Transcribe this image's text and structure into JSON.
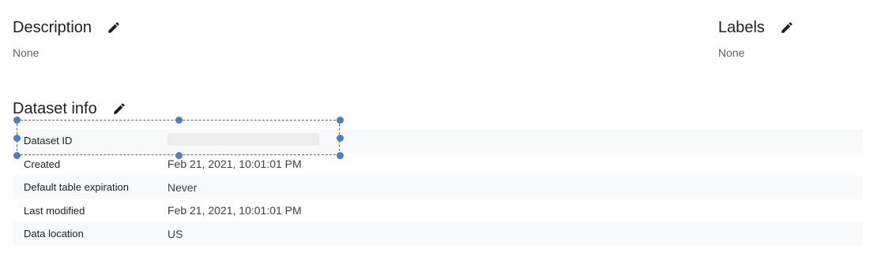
{
  "description": {
    "title": "Description",
    "value": "None",
    "edit_icon": "pencil-icon"
  },
  "labels": {
    "title": "Labels",
    "value": "None",
    "edit_icon": "pencil-icon"
  },
  "dataset_info": {
    "title": "Dataset info",
    "edit_icon": "pencil-icon",
    "rows": [
      {
        "key": "Dataset ID",
        "value": ""
      },
      {
        "key": "Created",
        "value": "Feb 21, 2021, 10:01:01 PM"
      },
      {
        "key": "Default table expiration",
        "value": "Never"
      },
      {
        "key": "Last modified",
        "value": "Feb 21, 2021, 10:01:01 PM"
      },
      {
        "key": "Data location",
        "value": "US"
      }
    ]
  },
  "colors": {
    "selection_handle": "#4a7fc1",
    "row_shade": "#f8f9fa",
    "text_primary": "#202124",
    "text_secondary": "#5f6368"
  }
}
